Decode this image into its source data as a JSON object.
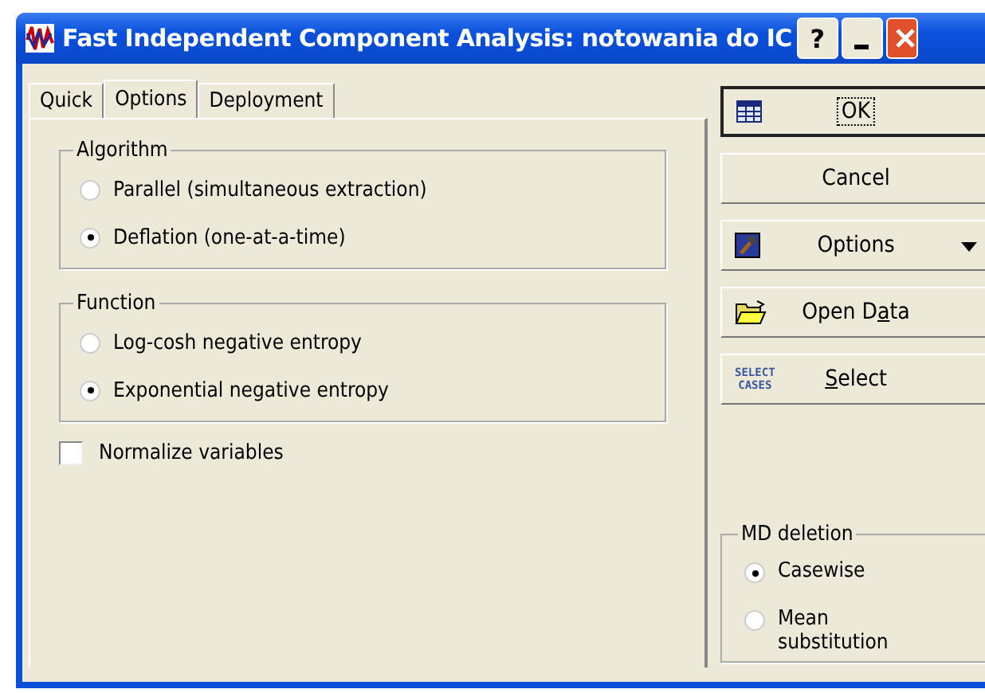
{
  "window": {
    "title": "Fast Independent Component Analysis: notowania do IC",
    "controls": [
      {
        "kind": "help",
        "label": "?"
      },
      {
        "kind": "minimize"
      },
      {
        "kind": "close"
      }
    ]
  },
  "tabs": [
    {
      "label": "Quick",
      "selected": false
    },
    {
      "label": "Options",
      "selected": true
    },
    {
      "label": "Deployment",
      "selected": false
    }
  ],
  "groups": [
    {
      "title": "Algorithm",
      "options": [
        {
          "label": "Parallel (simultaneous extraction)",
          "selected": false
        },
        {
          "label": "Deflation (one-at-a-time)",
          "selected": true
        }
      ]
    },
    {
      "title": "Function",
      "options": [
        {
          "label": "Log-cosh negative entropy",
          "selected": false
        },
        {
          "label": "Exponential negative entropy",
          "selected": true
        }
      ]
    }
  ],
  "normalize": {
    "label": "Normalize variables",
    "checked": false
  },
  "buttons": [
    {
      "kind": "ok",
      "label": {
        "before": "OK"
      },
      "focused": true
    },
    {
      "kind": "plain",
      "label": {
        "before": "Cancel"
      },
      "focused": false
    },
    {
      "kind": "options",
      "label": {
        "before": "Options"
      },
      "focused": false
    },
    {
      "kind": "open",
      "label": {
        "before": "Open D",
        "key": "a",
        "after": "ta"
      },
      "focused": false
    },
    {
      "kind": "select",
      "label": {
        "key": "S",
        "after": "elect"
      },
      "icon_text": [
        "SELECT",
        "CASES"
      ],
      "focused": false
    }
  ],
  "md_deletion": {
    "title": "MD deletion",
    "options": [
      {
        "label": "Casewise",
        "selected": true
      },
      {
        "label": "Mean substitution",
        "selected": false
      }
    ]
  }
}
